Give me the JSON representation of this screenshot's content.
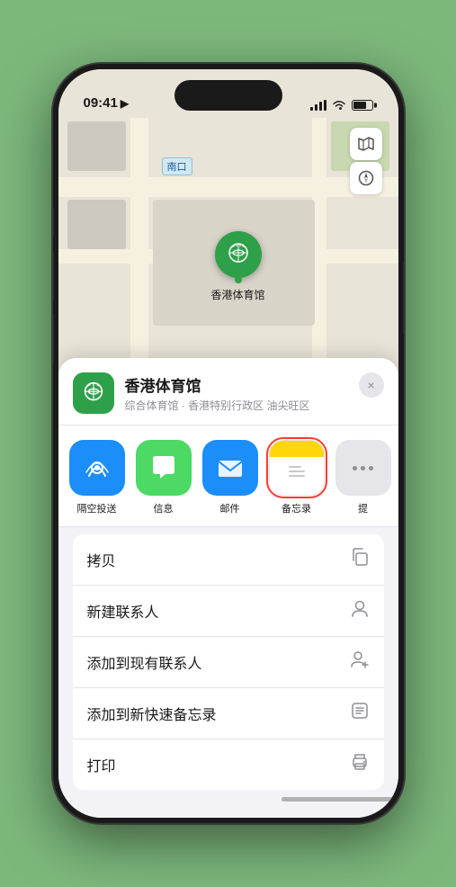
{
  "status_bar": {
    "time": "09:41",
    "location_icon": "▶"
  },
  "map": {
    "label_text": "南口",
    "venue_name_pin": "香港体育馆"
  },
  "sheet": {
    "venue_name": "香港体育馆",
    "venue_subtitle": "综合体育馆 · 香港特别行政区 油尖旺区",
    "close_label": "×"
  },
  "share_items": [
    {
      "id": "airdrop",
      "label": "隔空投送",
      "type": "airdrop"
    },
    {
      "id": "messages",
      "label": "信息",
      "type": "messages"
    },
    {
      "id": "mail",
      "label": "邮件",
      "type": "mail"
    },
    {
      "id": "notes",
      "label": "备忘录",
      "type": "notes",
      "highlighted": true
    },
    {
      "id": "more",
      "label": "提",
      "type": "more"
    }
  ],
  "actions": [
    {
      "id": "copy",
      "label": "拷贝",
      "icon": "copy"
    },
    {
      "id": "new-contact",
      "label": "新建联系人",
      "icon": "person"
    },
    {
      "id": "add-existing",
      "label": "添加到现有联系人",
      "icon": "person-add"
    },
    {
      "id": "add-notes",
      "label": "添加到新快速备忘录",
      "icon": "notes"
    },
    {
      "id": "print",
      "label": "打印",
      "icon": "print"
    }
  ]
}
